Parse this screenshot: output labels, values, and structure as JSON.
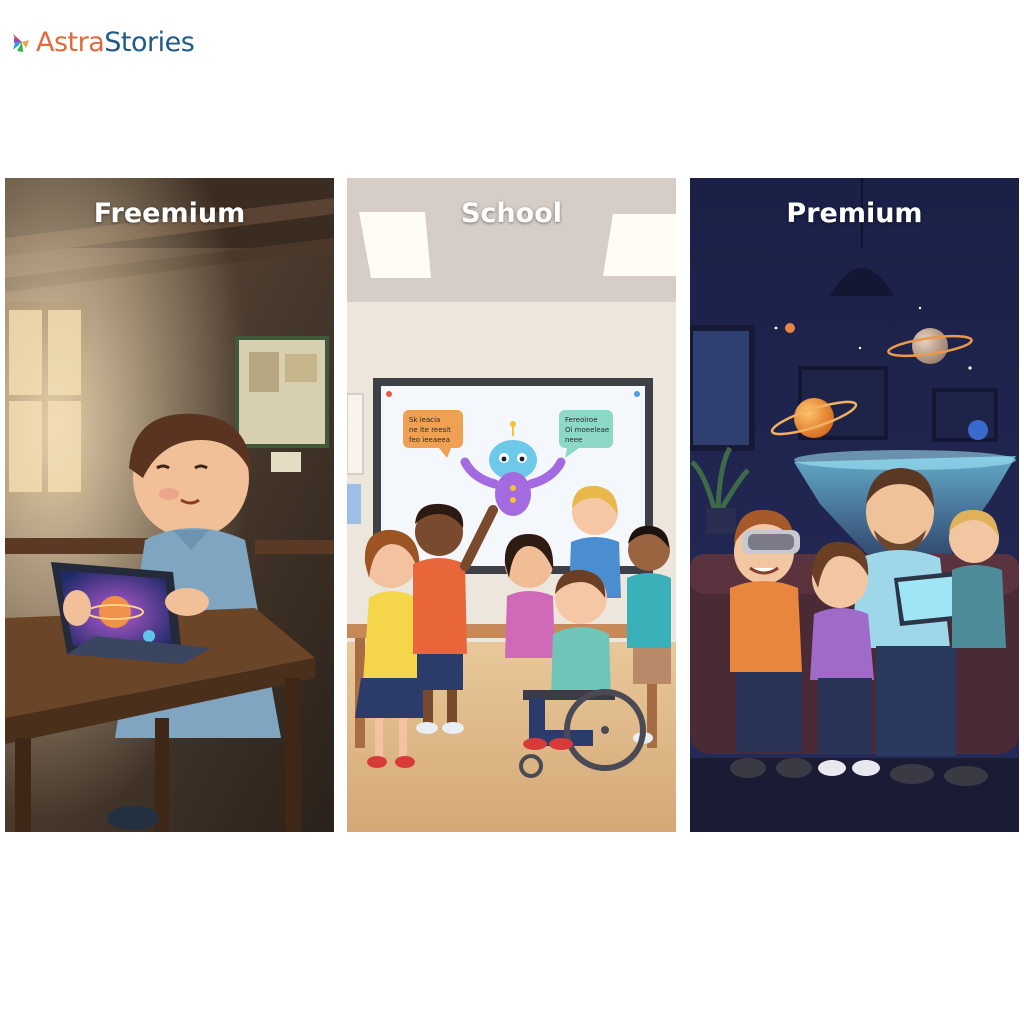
{
  "brand": {
    "name_part1": "Astra",
    "name_part2": "Stories",
    "colors": {
      "astra": "#e26a3a",
      "stories": "#1e5a8a"
    },
    "logo_icon": "feather-fan-icon"
  },
  "tiers": [
    {
      "label": "Freemium",
      "scene": "child-with-tablet-in-rustic-classroom"
    },
    {
      "label": "School",
      "scene": "children-and-alien-character-on-classroom-smartboard"
    },
    {
      "label": "Premium",
      "scene": "family-on-sofa-with-vr-headset-and-planet-hologram"
    }
  ],
  "smartboard": {
    "bubble_left": [
      "Sk ieacia",
      "ne ite reesit",
      "feo ieeaeea"
    ],
    "bubble_right": [
      "Fereoiroe",
      "Oi moeeleae",
      "neee"
    ]
  }
}
